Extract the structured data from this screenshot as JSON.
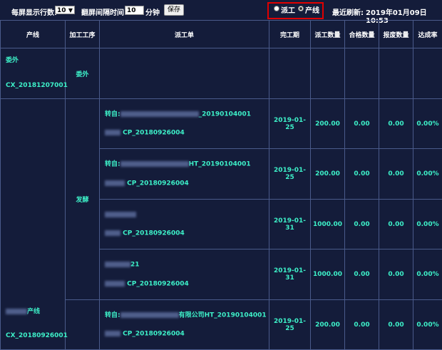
{
  "toolbar": {
    "rows_label": "每屏显示行数:",
    "rows_value": "10",
    "interval_label": "翻屏间隔时间:",
    "interval_value": "10",
    "interval_unit": "分钟",
    "save_label": "保存",
    "radio_dispatch_label": "派工",
    "radio_line_label": "产线",
    "refresh_label": "最近刷新:",
    "refresh_time": "2019年01月09日 10:53"
  },
  "table": {
    "headers": [
      "产线",
      "加工工序",
      "派工单",
      "完工期",
      "派工数量",
      "合格数量",
      "报废数量",
      "达成率"
    ],
    "group1": {
      "line_name": "委外",
      "line_code": "CX_20181207001",
      "process": "委外"
    },
    "group2": {
      "line_name": "产线",
      "line_code": "CX_20180926001",
      "process": "发酵"
    },
    "rows": [
      {
        "order_a": "转自:",
        "order_a_tail": "_20190104001",
        "order_b": "CP_20180926004",
        "date": "2019-01-25",
        "qty": "200.00",
        "ok": "0.00",
        "scrap": "0.00",
        "rate": "0.00%"
      },
      {
        "order_a": "转自:",
        "order_a_tail": "HT_20190104001",
        "order_b": "CP_20180926004",
        "date": "2019-01-25",
        "qty": "200.00",
        "ok": "0.00",
        "scrap": "0.00",
        "rate": "0.00%"
      },
      {
        "order_a": "",
        "order_a_tail": "",
        "order_b": "CP_20180926004",
        "date": "2019-01-31",
        "qty": "1000.00",
        "ok": "0.00",
        "scrap": "0.00",
        "rate": "0.00%"
      },
      {
        "order_a": "",
        "order_a_tail": "21",
        "order_b": "CP_20180926004",
        "date": "2019-01-31",
        "qty": "1000.00",
        "ok": "0.00",
        "scrap": "0.00",
        "rate": "0.00%"
      },
      {
        "order_a": "转自:",
        "order_a_tail": "有限公司HT_20190104001",
        "order_b": "CP_20180926004",
        "date": "2019-01-25",
        "qty": "200.00",
        "ok": "0.00",
        "scrap": "0.00",
        "rate": "0.00%"
      }
    ]
  }
}
